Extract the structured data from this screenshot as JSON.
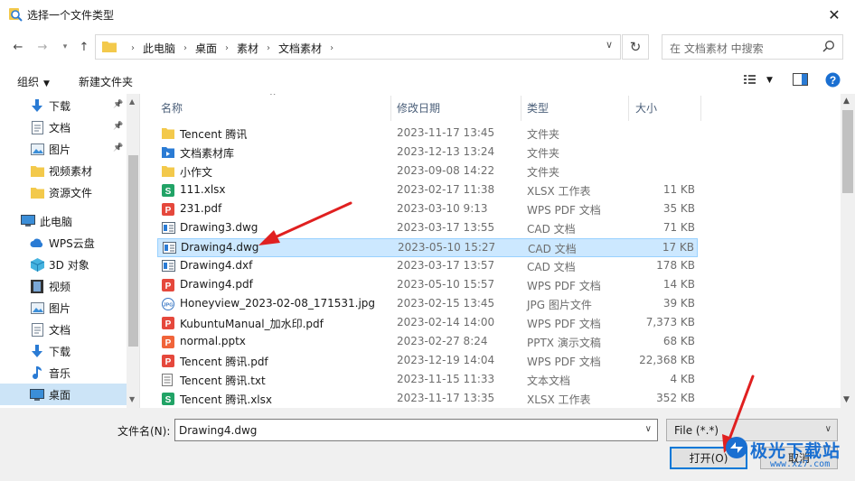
{
  "window": {
    "title": "选择一个文件类型"
  },
  "address": {
    "crumbs": [
      "此电脑",
      "桌面",
      "素材",
      "文档素材"
    ],
    "search_placeholder": "在 文档素材 中搜索"
  },
  "toolbar": {
    "organize": "组织",
    "new_folder": "新建文件夹"
  },
  "nav": {
    "items": [
      {
        "label": "下载",
        "icon": "download-icon",
        "pinned": true
      },
      {
        "label": "文档",
        "icon": "document-icon",
        "pinned": true
      },
      {
        "label": "图片",
        "icon": "picture-icon",
        "pinned": true
      },
      {
        "label": "视频素材",
        "icon": "folder-icon",
        "pinned": false
      },
      {
        "label": "资源文件",
        "icon": "folder-icon",
        "pinned": false
      },
      {
        "label": "此电脑",
        "icon": "computer-icon",
        "pinned": false
      },
      {
        "label": "WPS云盘",
        "icon": "cloud-icon",
        "pinned": false
      },
      {
        "label": "3D 对象",
        "icon": "3d-objects-icon",
        "pinned": false
      },
      {
        "label": "视频",
        "icon": "video-icon",
        "pinned": false
      },
      {
        "label": "图片",
        "icon": "picture-icon",
        "pinned": false
      },
      {
        "label": "文档",
        "icon": "document-icon",
        "pinned": false
      },
      {
        "label": "下载",
        "icon": "download-icon",
        "pinned": false
      },
      {
        "label": "音乐",
        "icon": "music-icon",
        "pinned": false
      },
      {
        "label": "桌面",
        "icon": "desktop-icon",
        "pinned": false,
        "selected": true
      }
    ]
  },
  "columns": {
    "name": "名称",
    "date": "修改日期",
    "type": "类型",
    "size": "大小"
  },
  "files": [
    {
      "name": "Tencent 腾讯",
      "date": "2023-11-17 13:45",
      "type": "文件夹",
      "size": "",
      "icon": "folder"
    },
    {
      "name": "文档素材库",
      "date": "2023-12-13 13:24",
      "type": "文件夹",
      "size": "",
      "icon": "folder-special"
    },
    {
      "name": "小作文",
      "date": "2023-09-08 14:22",
      "type": "文件夹",
      "size": "",
      "icon": "folder"
    },
    {
      "name": "111.xlsx",
      "date": "2023-02-17 11:38",
      "type": "XLSX 工作表",
      "size": "11 KB",
      "icon": "xlsx"
    },
    {
      "name": "231.pdf",
      "date": "2023-03-10 9:13",
      "type": "WPS PDF 文档",
      "size": "35 KB",
      "icon": "pdf"
    },
    {
      "name": "Drawing3.dwg",
      "date": "2023-03-17 13:55",
      "type": "CAD 文档",
      "size": "71 KB",
      "icon": "cad"
    },
    {
      "name": "Drawing4.dwg",
      "date": "2023-05-10 15:27",
      "type": "CAD 文档",
      "size": "17 KB",
      "icon": "cad",
      "selected": true
    },
    {
      "name": "Drawing4.dxf",
      "date": "2023-03-17 13:57",
      "type": "CAD 文档",
      "size": "178 KB",
      "icon": "cad"
    },
    {
      "name": "Drawing4.pdf",
      "date": "2023-05-10 15:57",
      "type": "WPS PDF 文档",
      "size": "14 KB",
      "icon": "pdf"
    },
    {
      "name": "Honeyview_2023-02-08_171531.jpg",
      "date": "2023-02-15 13:45",
      "type": "JPG 图片文件",
      "size": "39 KB",
      "icon": "jpg"
    },
    {
      "name": "KubuntuManual_加水印.pdf",
      "date": "2023-02-14 14:00",
      "type": "WPS PDF 文档",
      "size": "7,373 KB",
      "icon": "pdf"
    },
    {
      "name": "normal.pptx",
      "date": "2023-02-27 8:24",
      "type": "PPTX 演示文稿",
      "size": "68 KB",
      "icon": "pptx"
    },
    {
      "name": "Tencent 腾讯.pdf",
      "date": "2023-12-19 14:04",
      "type": "WPS PDF 文档",
      "size": "22,368 KB",
      "icon": "pdf"
    },
    {
      "name": "Tencent 腾讯.txt",
      "date": "2023-11-15 11:33",
      "type": "文本文档",
      "size": "4 KB",
      "icon": "txt"
    },
    {
      "name": "Tencent 腾讯.xlsx",
      "date": "2023-11-17 13:35",
      "type": "XLSX 工作表",
      "size": "352 KB",
      "icon": "xlsx"
    }
  ],
  "bottom": {
    "filename_label": "文件名(N):",
    "filename_value": "Drawing4.dwg",
    "filetype_value": "File (*.*)",
    "open_label": "打开(O)",
    "cancel_label": "取消"
  },
  "watermark": {
    "brand": "极光下载站",
    "site": "www.xz7.com"
  },
  "colors": {
    "selection": "#cce8ff",
    "accent": "#0078d7",
    "arrow": "#e02020"
  }
}
